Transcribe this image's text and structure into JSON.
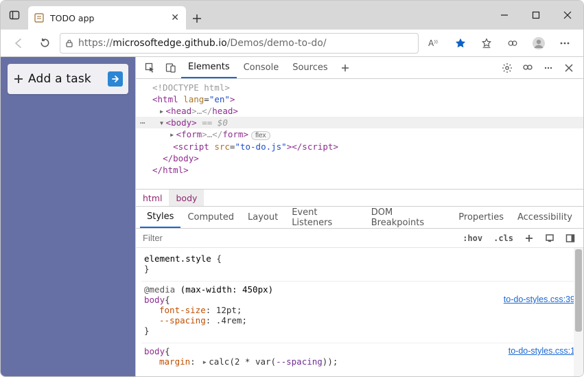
{
  "tab": {
    "title": "TODO app"
  },
  "url": {
    "protocol": "https://",
    "host": "microsoftedge.github.io",
    "path": "/Demos/demo-to-do/"
  },
  "page": {
    "task_placeholder": "Add a task"
  },
  "devtools": {
    "topTabs": {
      "elements": "Elements",
      "console": "Console",
      "sources": "Sources"
    },
    "dom": {
      "doctype": "<!DOCTYPE html>",
      "htmlOpen_pre": "<",
      "htmlTag": "html",
      "htmlLangName": "lang",
      "htmlLangVal": "\"en\"",
      "htmlOpen_post": ">",
      "headCollapsed_pre": "<",
      "headTag": "head",
      "headMid": ">…</",
      "headClose": ">",
      "bodyOpen_pre": "<",
      "bodyTag": "body",
      "bodyOpen_post": ">",
      "bodyEq": " == $0",
      "formCollapsed_pre": "<",
      "formTag": "form",
      "formMid": ">…</",
      "formClose": ">",
      "flexBadge": "flex",
      "scriptOpen_pre": "<",
      "scriptTag": "script",
      "scriptSrcName": "src",
      "scriptSrcVal": "\"to-do.js\"",
      "scriptOpen_post": ">",
      "scriptClose_pre": "</",
      "scriptClose_post": ">",
      "bodyClose_pre": "</",
      "bodyClose_post": ">",
      "htmlClose_pre": "</",
      "htmlClose_post": ">"
    },
    "crumbs": {
      "html": "html",
      "body": "body"
    },
    "subtabs": {
      "styles": "Styles",
      "computed": "Computed",
      "layout": "Layout",
      "eventListeners": "Event Listeners",
      "domBreakpoints": "DOM Breakpoints",
      "properties": "Properties",
      "accessibility": "Accessibility"
    },
    "filter": {
      "placeholder": "Filter",
      "hov": ":hov",
      "cls": ".cls"
    },
    "styles": {
      "elementStyle_sel": "element.style",
      "media_kw": "@media",
      "media_cond": " (max-width: 450px)",
      "body_sel": "body",
      "fontSize_prop": "font-size",
      "fontSize_val": "12pt",
      "spacing_prop": "--spacing",
      "spacing_val": ".4rem",
      "link1": "to-do-styles.css:39",
      "margin_prop": "margin",
      "margin_calc_pre": "calc(2 * var(",
      "margin_var": "--spacing",
      "margin_calc_post": "))",
      "link2": "to-do-styles.css:1"
    }
  }
}
